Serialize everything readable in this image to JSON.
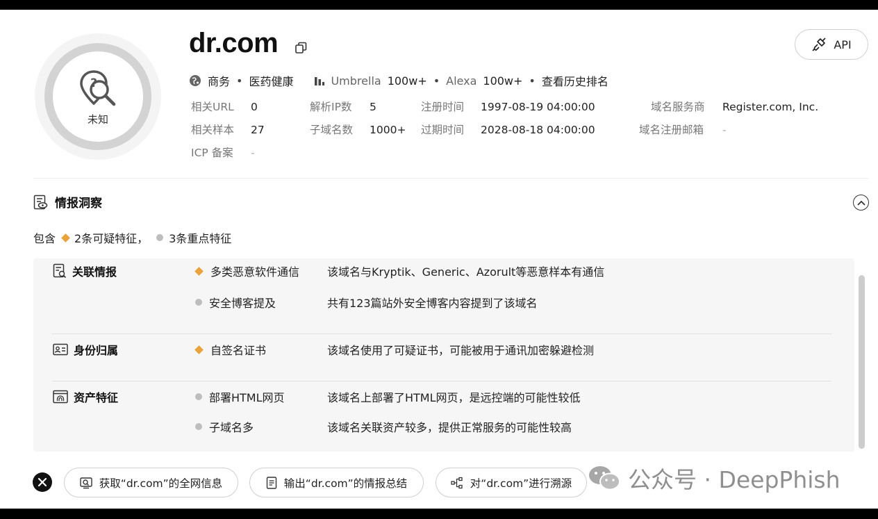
{
  "header": {
    "domain": "dr.com",
    "badge_label": "未知",
    "api_label": "API",
    "tags": {
      "category1": "商务",
      "category2": "医药健康",
      "umbrella_label": "Umbrella",
      "umbrella_value": "100w+",
      "alexa_label": "Alexa",
      "alexa_value": "100w+",
      "history_link": "查看历史排名"
    },
    "info": {
      "related_url_label": "相关URL",
      "related_url_value": "0",
      "resolved_ip_label": "解析IP数",
      "resolved_ip_value": "5",
      "reg_time_label": "注册时间",
      "reg_time_value": "1997-08-19 04:00:00",
      "registrar_label": "域名服务商",
      "registrar_value": "Register.com, Inc.",
      "related_sample_label": "相关样本",
      "related_sample_value": "27",
      "subdomain_label": "子域名数",
      "subdomain_value": "1000+",
      "expire_label": "过期时间",
      "expire_value": "2028-08-18 04:00:00",
      "reg_email_label": "域名注册邮箱",
      "reg_email_value": "-",
      "icp_label": "ICP 备案",
      "icp_value": "-"
    }
  },
  "insight": {
    "title": "情报洞察",
    "summary_prefix": "包含",
    "suspicious": "2条可疑特征，",
    "key": "3条重点特征",
    "categories": [
      {
        "name": "关联情报",
        "features": [
          {
            "name": "多类恶意软件通信",
            "level": "suspicious",
            "desc": "该域名与Kryptik、Generic、Azorult等恶意样本有通信"
          },
          {
            "name": "安全博客提及",
            "level": "key",
            "desc": "共有123篇站外安全博客内容提到了该域名"
          }
        ]
      },
      {
        "name": "身份归属",
        "features": [
          {
            "name": "自签名证书",
            "level": "suspicious",
            "desc": "该域名使用了可疑证书，可能被用于通讯加密躲避检测"
          }
        ]
      },
      {
        "name": "资产特征",
        "features": [
          {
            "name": "部署HTML网页",
            "level": "key",
            "desc": "该域名上部署了HTML网页，是远控端的可能性较低"
          },
          {
            "name": "子域名多",
            "level": "key",
            "desc": "该域名关联资产较多，提供正常服务的可能性较高"
          }
        ]
      }
    ]
  },
  "actions": [
    {
      "label": "获取“dr.com”的全网信息",
      "icon": "search-icon"
    },
    {
      "label": "输出“dr.com”的情报总结",
      "icon": "document-icon"
    },
    {
      "label": "对“dr.com”进行溯源",
      "icon": "trace-icon"
    }
  ],
  "watermark": "公众号 · DeepPhish",
  "colors": {
    "suspicious": "#e8a33c",
    "key": "#bdbdbd",
    "panel_bg": "#f6f6f6"
  }
}
